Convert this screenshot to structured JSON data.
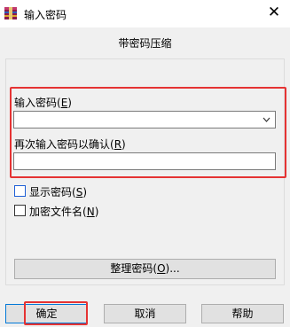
{
  "window": {
    "title": "输入密码",
    "close_glyph": "✕",
    "icon": "winrar-app-icon"
  },
  "dialog": {
    "heading": "带密码压缩",
    "password_label": {
      "text": "输入密码",
      "mnemonic_open": "(",
      "mnemonic_key": "E",
      "mnemonic_close": ")"
    },
    "password_value": "",
    "confirm_label": {
      "text": "再次输入密码以确认",
      "mnemonic_open": "(",
      "mnemonic_key": "R",
      "mnemonic_close": ")"
    },
    "confirm_value": "",
    "show_password": {
      "text": "显示密码",
      "mnemonic_open": "(",
      "mnemonic_key": "S",
      "mnemonic_close": ")",
      "checked": false
    },
    "encrypt_filenames": {
      "text": "加密文件名",
      "mnemonic_open": "(",
      "mnemonic_key": "N",
      "mnemonic_close": ")",
      "checked": false
    },
    "organize_button": {
      "text": "整理密码",
      "mnemonic_open": "(",
      "mnemonic_key": "O",
      "mnemonic_close": ")...",
      "suffix": ""
    }
  },
  "buttons": {
    "ok": "确定",
    "cancel": "取消",
    "help": "帮助"
  },
  "colors": {
    "highlight": "#e53333",
    "focus_blue": "#0078d7",
    "dialog_bg": "#f0f0f0"
  }
}
